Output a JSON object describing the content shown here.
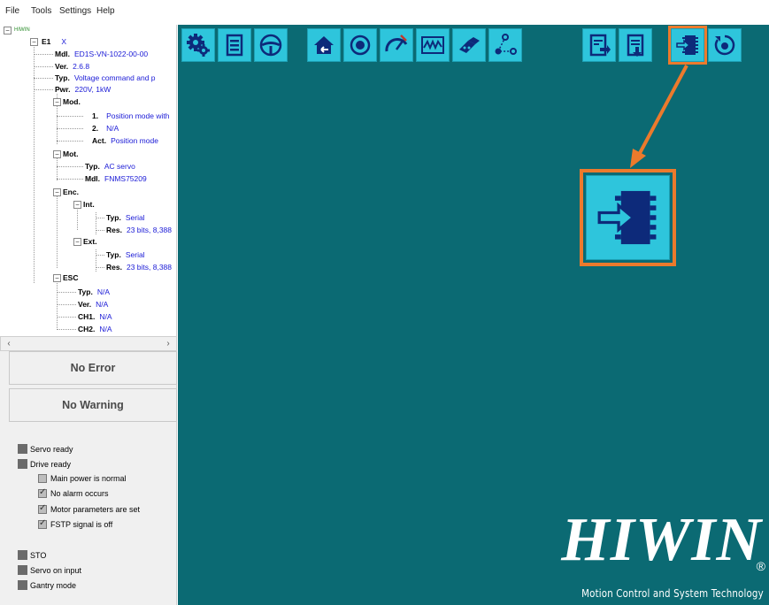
{
  "menu": [
    "File",
    "Tools",
    "Settings",
    "Help"
  ],
  "tree": {
    "root": "HIWIN",
    "axis": {
      "key": "E1",
      "value": "X"
    },
    "model": {
      "key": "Mdl.",
      "value": "ED1S-VN-1022-00-00"
    },
    "version": {
      "key": "Ver.",
      "value": "2.6.8"
    },
    "type": {
      "key": "Typ.",
      "value": "Voltage command and p"
    },
    "power": {
      "key": "Pwr.",
      "value": "220V, 1kW"
    },
    "mode": {
      "label": "Mod.",
      "one": {
        "key": "1.",
        "value": "Position mode with"
      },
      "two": {
        "key": "2.",
        "value": "N/A"
      },
      "act": {
        "key": "Act.",
        "value": "Position mode"
      }
    },
    "motor": {
      "label": "Mot.",
      "type": {
        "key": "Typ.",
        "value": "AC servo"
      },
      "model": {
        "key": "Mdl.",
        "value": "FNMS75209"
      }
    },
    "encoder": {
      "label": "Enc.",
      "int": {
        "label": "Int.",
        "type": {
          "key": "Typ.",
          "value": "Serial"
        },
        "res": {
          "key": "Res.",
          "value": "23 bits, 8,388"
        }
      },
      "ext": {
        "label": "Ext.",
        "type": {
          "key": "Typ.",
          "value": "Serial"
        },
        "res": {
          "key": "Res.",
          "value": "23 bits, 8,388"
        }
      }
    },
    "esc": {
      "label": "ESC",
      "type": {
        "key": "Typ.",
        "value": "N/A"
      },
      "ver": {
        "key": "Ver.",
        "value": "N/A"
      },
      "ch1": {
        "key": "CH1.",
        "value": "N/A"
      },
      "ch2": {
        "key": "CH2.",
        "value": "N/A"
      }
    }
  },
  "status": {
    "error": "No Error",
    "warning": "No Warning"
  },
  "indicators": {
    "servo_ready": "Servo ready",
    "drive_ready": "Drive ready",
    "main_power": "Main power is normal",
    "no_alarm": "No alarm occurs",
    "motor_params": "Motor parameters are set",
    "fstp": "FSTP signal is off",
    "sto": "STO",
    "servo_on": "Servo on input",
    "gantry": "Gantry mode"
  },
  "toolbar_icons": [
    "gear-icon",
    "list-icon",
    "steering-wheel-icon",
    "home-icon",
    "eye-icon",
    "gauge-icon",
    "waveform-icon",
    "tools-icon",
    "nodes-icon",
    "export-doc-icon",
    "import-doc-icon",
    "download-chip-icon",
    "reset-icon"
  ],
  "brand": {
    "logo": "HIWIN",
    "registered": "®",
    "slogan": "Motion Control and System Technology"
  },
  "colors": {
    "accent": "#ec7a2c",
    "background": "#0b6a73",
    "button": "#2ec5dc"
  }
}
